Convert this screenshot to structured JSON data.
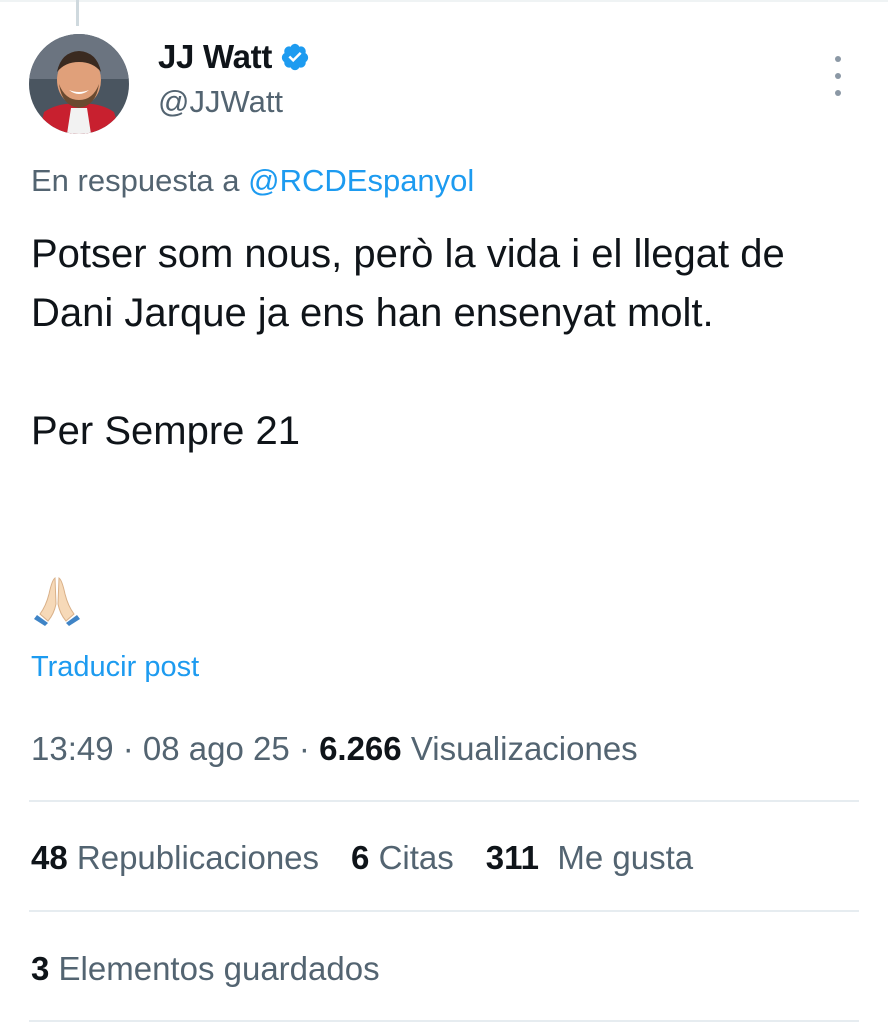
{
  "author": {
    "display_name": "JJ Watt",
    "handle": "@JJWatt",
    "verified": true,
    "verified_color": "#1d9bf0"
  },
  "reply": {
    "prefix": "En respuesta a ",
    "mention": "@RCDEspanyol"
  },
  "tweet": {
    "paragraph1": "Potser som nous, però la vida i el llegat de Dani Jarque ja ens han ensenyat molt.",
    "paragraph2": "Per Sempre 21",
    "emoji_icon": "folded-hands-emoji"
  },
  "translate_label": "Traducir post",
  "meta": {
    "time": "13:49",
    "separator": " · ",
    "date": "08 ago 25",
    "views_count": "6.266",
    "views_label": " Visualizaciones"
  },
  "stats": {
    "reposts_count": "48",
    "reposts_label": " Republicaciones",
    "quotes_count": "6",
    "quotes_label": " Citas",
    "likes_count": "311",
    "likes_label": "  Me gusta"
  },
  "bookmarks": {
    "count": "3",
    "label": " Elementos guardados"
  },
  "colors": {
    "link": "#1d9bf0",
    "secondary_text": "#536471",
    "primary_text": "#0f1419",
    "divider": "#e6ecf0"
  }
}
